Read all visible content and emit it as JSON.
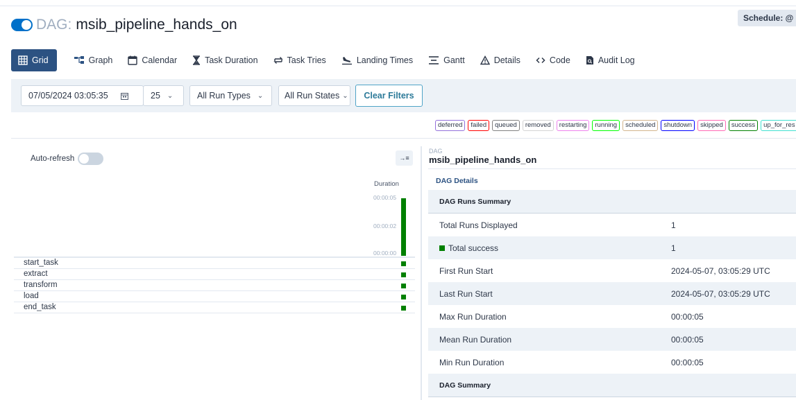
{
  "header": {
    "schedule_label": "Schedule: @",
    "dag_prefix": "DAG:",
    "dag_id": "msib_pipeline_hands_on"
  },
  "tabs": [
    {
      "label": "Grid",
      "icon": "grid-icon",
      "active": true
    },
    {
      "label": "Graph",
      "icon": "graph-icon"
    },
    {
      "label": "Calendar",
      "icon": "calendar-icon"
    },
    {
      "label": "Task Duration",
      "icon": "hourglass-icon"
    },
    {
      "label": "Task Tries",
      "icon": "retry-icon"
    },
    {
      "label": "Landing Times",
      "icon": "plane-landing-icon"
    },
    {
      "label": "Gantt",
      "icon": "gantt-icon"
    },
    {
      "label": "Details",
      "icon": "warning-triangle-icon"
    },
    {
      "label": "Code",
      "icon": "code-icon"
    },
    {
      "label": "Audit Log",
      "icon": "audit-log-icon"
    }
  ],
  "filters": {
    "datetime": "07/05/2024 03:05:35",
    "num_runs": "25",
    "run_type": "All Run Types",
    "run_state": "All Run States",
    "clear_label": "Clear Filters"
  },
  "legend": [
    {
      "label": "deferred",
      "color": "#9370db"
    },
    {
      "label": "failed",
      "color": "#ff0000"
    },
    {
      "label": "queued",
      "color": "#808080"
    },
    {
      "label": "removed",
      "color": "#d3d3d3"
    },
    {
      "label": "restarting",
      "color": "#ee82ee"
    },
    {
      "label": "running",
      "color": "#00ff00"
    },
    {
      "label": "scheduled",
      "color": "#d2b48c"
    },
    {
      "label": "shutdown",
      "color": "#0000ff"
    },
    {
      "label": "skipped",
      "color": "#ff69b4"
    },
    {
      "label": "success",
      "color": "#008000"
    },
    {
      "label": "up_for_res",
      "color": "#40e0d0"
    }
  ],
  "grid": {
    "auto_refresh_label": "Auto-refresh",
    "duration_label": "Duration",
    "ticks": [
      "00:00:05",
      "00:00:02",
      "00:00:00"
    ],
    "tasks": [
      "start_task",
      "extract",
      "transform",
      "load",
      "end_task"
    ]
  },
  "details": {
    "dag_label": "DAG",
    "dag_id": "msib_pipeline_hands_on",
    "details_link": "DAG Details",
    "runs_summary_title": "DAG Runs Summary",
    "rows": [
      {
        "label": "Total Runs Displayed",
        "value": "1"
      },
      {
        "label": "Total success",
        "value": "1"
      },
      {
        "label": "First Run Start",
        "value": "2024-05-07, 03:05:29 UTC"
      },
      {
        "label": "Last Run Start",
        "value": "2024-05-07, 03:05:29 UTC"
      },
      {
        "label": "Max Run Duration",
        "value": "00:00:05"
      },
      {
        "label": "Mean Run Duration",
        "value": "00:00:05"
      },
      {
        "label": "Min Run Duration",
        "value": "00:00:05"
      }
    ],
    "dag_summary_title": "DAG Summary"
  }
}
